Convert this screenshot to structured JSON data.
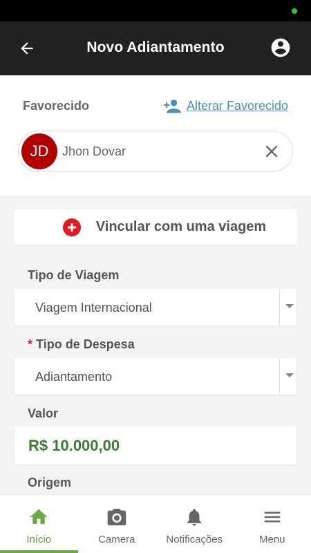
{
  "header": {
    "title": "Novo Adiantamento"
  },
  "favorecido": {
    "label": "Favorecido",
    "alter_link": "Alterar Favorecido",
    "selected": {
      "initials": "JD",
      "name": "Jhon Dovar",
      "avatar_color": "#b00000"
    }
  },
  "vincular": {
    "label": "Vincular com uma viagem",
    "icon_color": "#e31a23"
  },
  "fields": {
    "tipo_viagem": {
      "label": "Tipo de Viagem",
      "value": "Viagem Internacional"
    },
    "tipo_despesa": {
      "required_mark": "*",
      "label": "Tipo de Despesa",
      "value": "Adiantamento"
    },
    "valor": {
      "label": "Valor",
      "value": "R$ 10.000,00"
    },
    "origem": {
      "label": "Origem"
    }
  },
  "nav": {
    "items": [
      {
        "label": "Início",
        "icon": "home-icon",
        "active": true
      },
      {
        "label": "Camera",
        "icon": "camera-icon",
        "active": false
      },
      {
        "label": "Notificações",
        "icon": "bell-icon",
        "active": false
      },
      {
        "label": "Menu",
        "icon": "menu-icon",
        "active": false
      }
    ]
  },
  "colors": {
    "header_bg": "#222222",
    "accent_green": "#6aab45",
    "link_blue": "#4a90b8",
    "value_green": "#3c7a35"
  }
}
